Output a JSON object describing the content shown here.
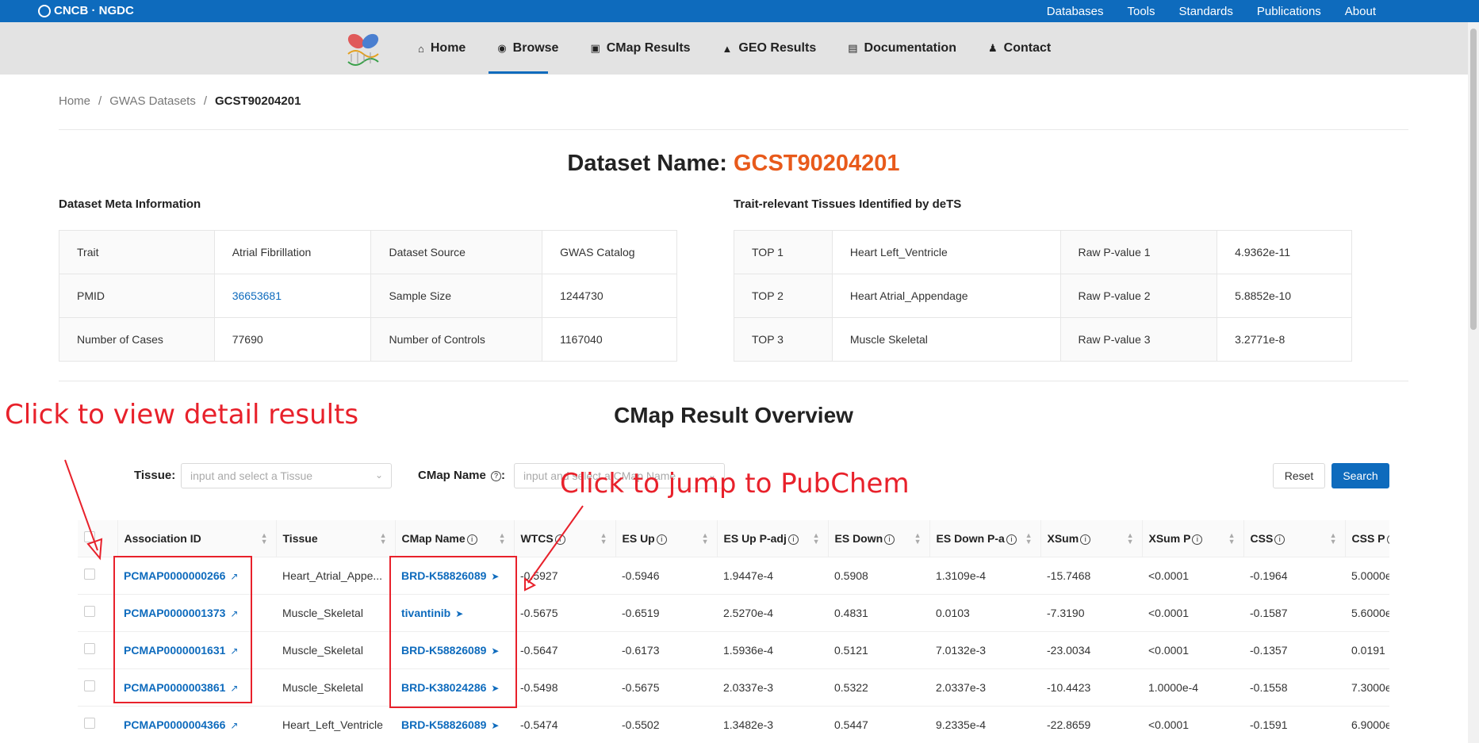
{
  "topbar": {
    "logo": "CNCB · NGDC",
    "links": [
      "Databases",
      "Tools",
      "Standards",
      "Publications",
      "About"
    ]
  },
  "nav": {
    "items": [
      {
        "label": "Home",
        "icon": "home-icon"
      },
      {
        "label": "Browse",
        "icon": "eye-icon"
      },
      {
        "label": "CMap Results",
        "icon": "binoculars-icon"
      },
      {
        "label": "GEO Results",
        "icon": "chart-icon"
      },
      {
        "label": "Documentation",
        "icon": "document-icon"
      },
      {
        "label": "Contact",
        "icon": "contact-icon"
      }
    ],
    "active": "Browse"
  },
  "breadcrumb": [
    "Home",
    "GWAS Datasets",
    "GCST90204201"
  ],
  "dataset": {
    "label": "Dataset Name:",
    "name": "GCST90204201"
  },
  "meta_title": "Dataset Meta Information",
  "meta_rows": [
    [
      "Trait",
      "Atrial Fibrillation",
      "Dataset Source",
      "GWAS Catalog"
    ],
    [
      "PMID",
      "36653681",
      "Sample Size",
      "1244730"
    ],
    [
      "Number of Cases",
      "77690",
      "Number of Controls",
      "1167040"
    ]
  ],
  "tissues_title": "Trait-relevant Tissues Identified by deTS",
  "tissue_rows": [
    [
      "TOP 1",
      "Heart Left_Ventricle",
      "Raw P-value 1",
      "4.9362e-11"
    ],
    [
      "TOP 2",
      "Heart Atrial_Appendage",
      "Raw P-value 2",
      "5.8852e-10"
    ],
    [
      "TOP 3",
      "Muscle Skeletal",
      "Raw P-value 3",
      "3.2771e-8"
    ]
  ],
  "overview_title": "CMap Result Overview",
  "filters": {
    "tissue_label": "Tissue",
    "tissue_placeholder": "input and select a Tissue",
    "cmap_label": "CMap Name",
    "cmap_placeholder": "input and select a CMap Name",
    "reset": "Reset",
    "search": "Search"
  },
  "columns": [
    "Association ID",
    "Tissue",
    "CMap Name",
    "WTCS",
    "ES Up",
    "ES Up P-adj",
    "ES Down",
    "ES Down P-a",
    "XSum",
    "XSum P",
    "CSS",
    "CSS P"
  ],
  "rows": [
    [
      "PCMAP0000000266",
      "Heart_Atrial_Appe...",
      "BRD-K58826089",
      "-0.5927",
      "-0.5946",
      "1.9447e-4",
      "0.5908",
      "1.3109e-4",
      "-15.7468",
      "<0.0001",
      "-0.1964",
      "5.0000e"
    ],
    [
      "PCMAP0000001373",
      "Muscle_Skeletal",
      "tivantinib",
      "-0.5675",
      "-0.6519",
      "2.5270e-4",
      "0.4831",
      "0.0103",
      "-7.3190",
      "<0.0001",
      "-0.1587",
      "5.6000e"
    ],
    [
      "PCMAP0000001631",
      "Muscle_Skeletal",
      "BRD-K58826089",
      "-0.5647",
      "-0.6173",
      "1.5936e-4",
      "0.5121",
      "7.0132e-3",
      "-23.0034",
      "<0.0001",
      "-0.1357",
      "0.0191"
    ],
    [
      "PCMAP0000003861",
      "Muscle_Skeletal",
      "BRD-K38024286",
      "-0.5498",
      "-0.5675",
      "2.0337e-3",
      "0.5322",
      "2.0337e-3",
      "-10.4423",
      "1.0000e-4",
      "-0.1558",
      "7.3000e"
    ],
    [
      "PCMAP0000004366",
      "Heart_Left_Ventricle",
      "BRD-K58826089",
      "-0.5474",
      "-0.5502",
      "1.3482e-3",
      "0.5447",
      "9.2335e-4",
      "-22.8659",
      "<0.0001",
      "-0.1591",
      "6.9000e"
    ]
  ],
  "annotations": {
    "detail": "Click to view detail results",
    "pubchem": "Click to jump to PubChem"
  },
  "colors": {
    "brand": "#0e6bbd",
    "accent": "#e85a1b",
    "annotation": "#e8212b"
  }
}
